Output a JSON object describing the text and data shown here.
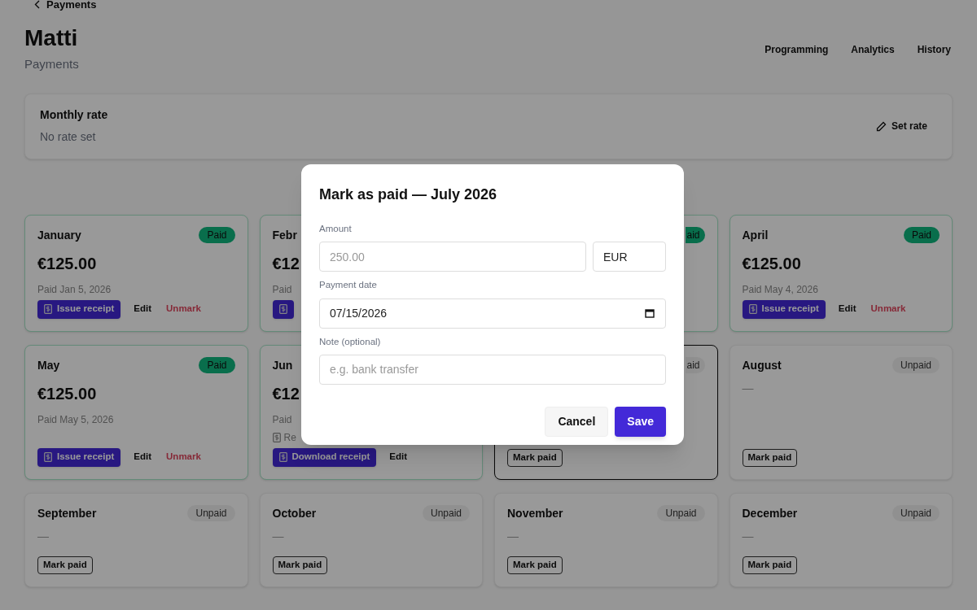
{
  "back_link": "Payments",
  "title": "Matti",
  "subtitle": "Payments",
  "nav": [
    "Programming",
    "Analytics",
    "History"
  ],
  "rate_card": {
    "title": "Monthly rate",
    "value": "No rate set",
    "action": "Set rate"
  },
  "months": [
    {
      "name": "January",
      "kind": "paid",
      "badge": "Paid",
      "amount": "€125.00",
      "detail": "Paid Jan 5, 2026",
      "actions": [
        {
          "kind": "primary",
          "label": "Issue receipt"
        },
        {
          "kind": "plain",
          "label": "Edit"
        },
        {
          "kind": "danger",
          "label": "Unmark"
        }
      ],
      "selected": false
    },
    {
      "name": "Febr",
      "kind": "paid",
      "amount": "€12",
      "detail": "Paid",
      "actions": [
        {
          "kind": "primary"
        }
      ],
      "selected": false
    },
    {
      "kind": "paid",
      "badge": "aid",
      "selected": false
    },
    {
      "name": "April",
      "kind": "paid",
      "badge": "Paid",
      "amount": "€125.00",
      "detail": "Paid May 4, 2026",
      "actions": [
        {
          "kind": "primary",
          "label": "Issue receipt"
        },
        {
          "kind": "plain",
          "label": "Edit"
        },
        {
          "kind": "danger",
          "label": "Unmark"
        }
      ],
      "selected": false
    },
    {
      "name": "May",
      "kind": "paid",
      "badge": "Paid",
      "amount": "€125.00",
      "detail": "Paid May 5, 2026",
      "actions": [
        {
          "kind": "primary",
          "label": "Issue receipt"
        },
        {
          "kind": "plain",
          "label": "Edit"
        },
        {
          "kind": "danger",
          "label": "Unmark"
        }
      ],
      "selected": false
    },
    {
      "name": "Jun",
      "kind": "paid",
      "amount": "€12",
      "detail": "Paid",
      "receipt_note": "Re",
      "actions": [
        {
          "kind": "primary",
          "label": "Download receipt"
        },
        {
          "kind": "plain",
          "label": "Edit"
        }
      ],
      "selected": false
    },
    {
      "kind": "unpaid",
      "badge": "aid",
      "actions": [
        {
          "kind": "outline",
          "label": "Mark paid"
        }
      ],
      "selected": true
    },
    {
      "name": "August",
      "kind": "unpaid",
      "badge": "Unpaid",
      "detail": "—",
      "actions": [
        {
          "kind": "outline",
          "label": "Mark paid"
        }
      ],
      "selected": false
    },
    {
      "name": "September",
      "kind": "unpaid",
      "badge": "Unpaid",
      "detail": "—",
      "actions": [
        {
          "kind": "outline",
          "label": "Mark paid"
        }
      ],
      "selected": false
    },
    {
      "name": "October",
      "kind": "unpaid",
      "badge": "Unpaid",
      "detail": "—",
      "actions": [
        {
          "kind": "outline",
          "label": "Mark paid"
        }
      ],
      "selected": false
    },
    {
      "name": "November",
      "kind": "unpaid",
      "badge": "Unpaid",
      "detail": "—",
      "actions": [
        {
          "kind": "outline",
          "label": "Mark paid"
        }
      ],
      "selected": false
    },
    {
      "name": "December",
      "kind": "unpaid",
      "badge": "Unpaid",
      "detail": "—",
      "actions": [
        {
          "kind": "outline",
          "label": "Mark paid"
        }
      ],
      "selected": false
    }
  ],
  "dialog": {
    "title": "Mark as paid — July 2026",
    "amount_label": "Amount",
    "amount_placeholder": "250.00",
    "currency": "EUR",
    "date_label": "Payment date",
    "date_value": "07/15/2026",
    "note_label": "Note (optional)",
    "note_placeholder": "e.g. bank transfer",
    "cancel": "Cancel",
    "save": "Save"
  }
}
